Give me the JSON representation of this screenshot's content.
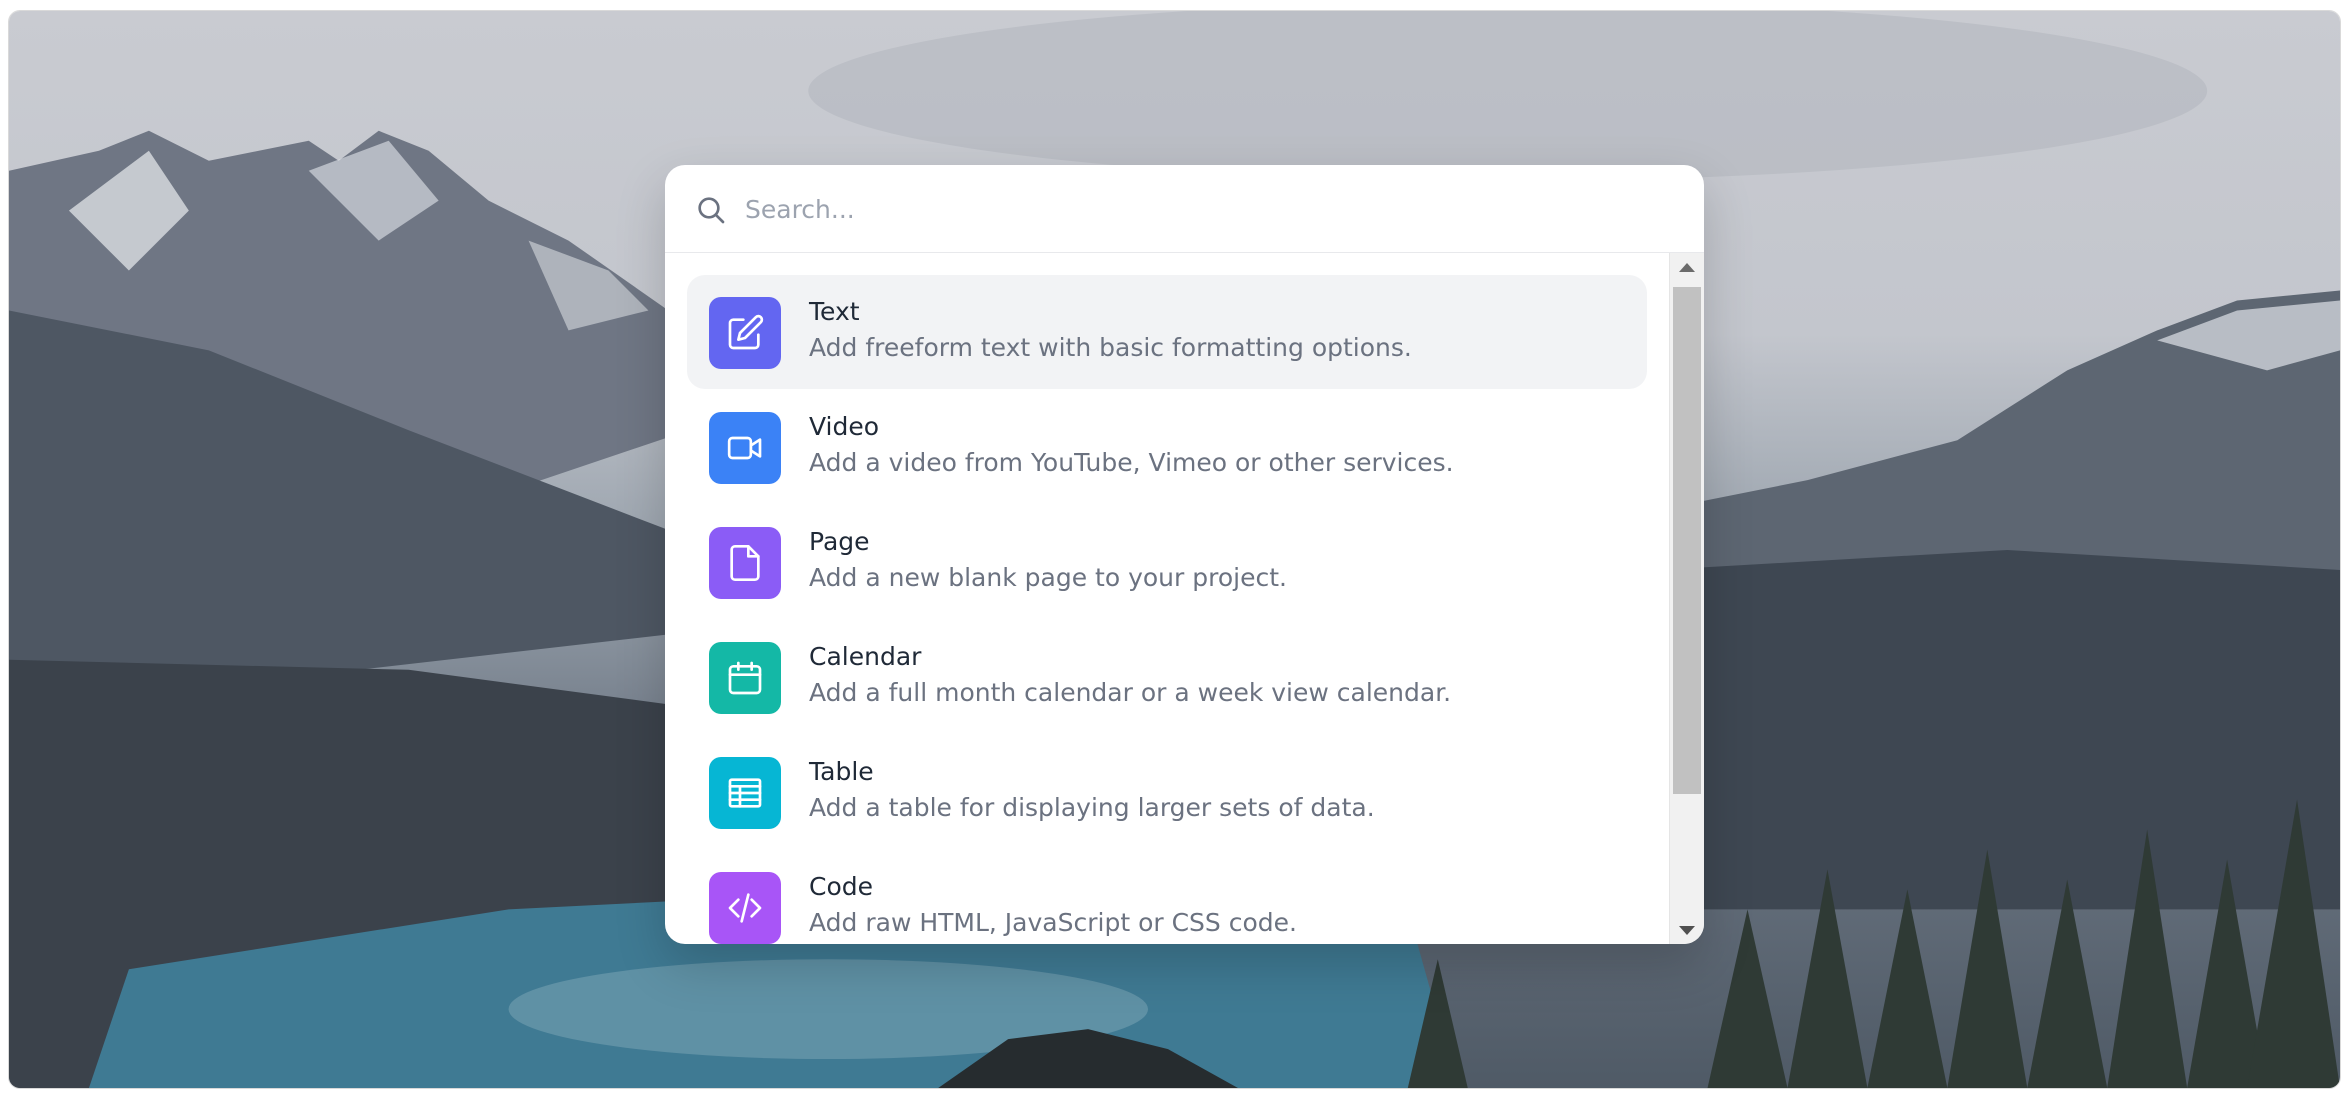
{
  "search": {
    "placeholder": "Search...",
    "value": ""
  },
  "items": [
    {
      "title": "Text",
      "description": "Add freeform text with basic formatting options.",
      "icon": "pencil-square-icon",
      "color": "#6366f1",
      "active": true
    },
    {
      "title": "Video",
      "description": "Add a video from YouTube, Vimeo or other services.",
      "icon": "video-camera-icon",
      "color": "#3b82f6",
      "active": false
    },
    {
      "title": "Page",
      "description": "Add a new blank page to your project.",
      "icon": "document-icon",
      "color": "#8b5cf6",
      "active": false
    },
    {
      "title": "Calendar",
      "description": "Add a full month calendar or a week view calendar.",
      "icon": "calendar-icon",
      "color": "#14b8a6",
      "active": false
    },
    {
      "title": "Table",
      "description": "Add a table for displaying larger sets of data.",
      "icon": "table-icon",
      "color": "#06b6d4",
      "active": false
    },
    {
      "title": "Code",
      "description": "Add raw HTML, JavaScript or CSS code.",
      "icon": "code-icon",
      "color": "#a855f7",
      "active": false
    }
  ]
}
